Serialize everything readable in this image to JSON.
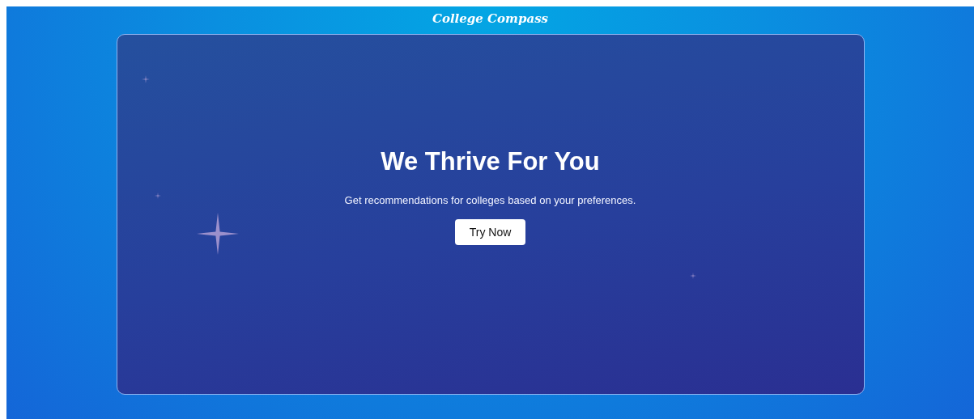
{
  "header": {
    "logo": "College Compass"
  },
  "hero": {
    "title": "We Thrive For You",
    "subtitle": "Get recommendations for colleges based on your preferences.",
    "button": "Try Now"
  }
}
